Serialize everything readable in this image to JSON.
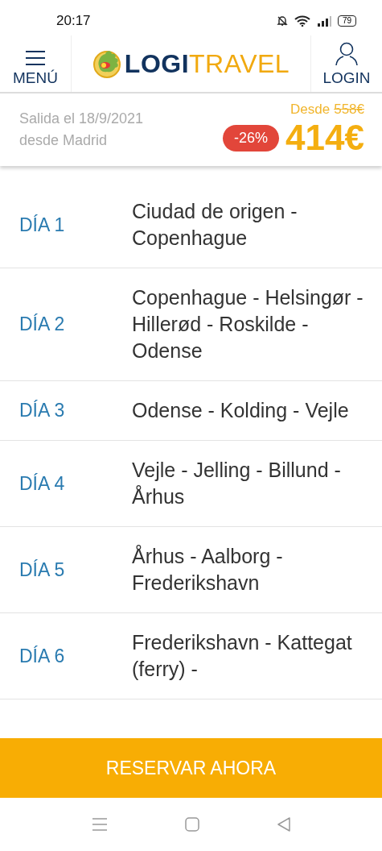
{
  "status_bar": {
    "time": "20:17",
    "battery": "79"
  },
  "header": {
    "menu_label": "MENÚ",
    "logo_parts": [
      "LOGI",
      "TRAVEL"
    ],
    "login_label": "LOGIN"
  },
  "summary": {
    "departure": "Salida el 18/9/2021",
    "origin": "desde Madrid",
    "from_label": "Desde",
    "old_price": "558€",
    "discount": "-26%",
    "price": "414€"
  },
  "days": [
    {
      "label": "DÍA 1",
      "route": "Ciudad de origen - Copenhague"
    },
    {
      "label": "DÍA 2",
      "route": "Copenhague - Helsingør - Hillerød - Roskilde - Odense"
    },
    {
      "label": "DÍA 3",
      "route": "Odense - Kolding - Vejle"
    },
    {
      "label": "DÍA 4",
      "route": "Vejle - Jelling - Billund - Århus"
    },
    {
      "label": "DÍA 5",
      "route": "Århus - Aalborg - Frederikshavn"
    },
    {
      "label": "DÍA 6",
      "route": "Frederikshavn - Kattegat (ferry) -"
    }
  ],
  "book_button": "RESERVAR AHORA"
}
